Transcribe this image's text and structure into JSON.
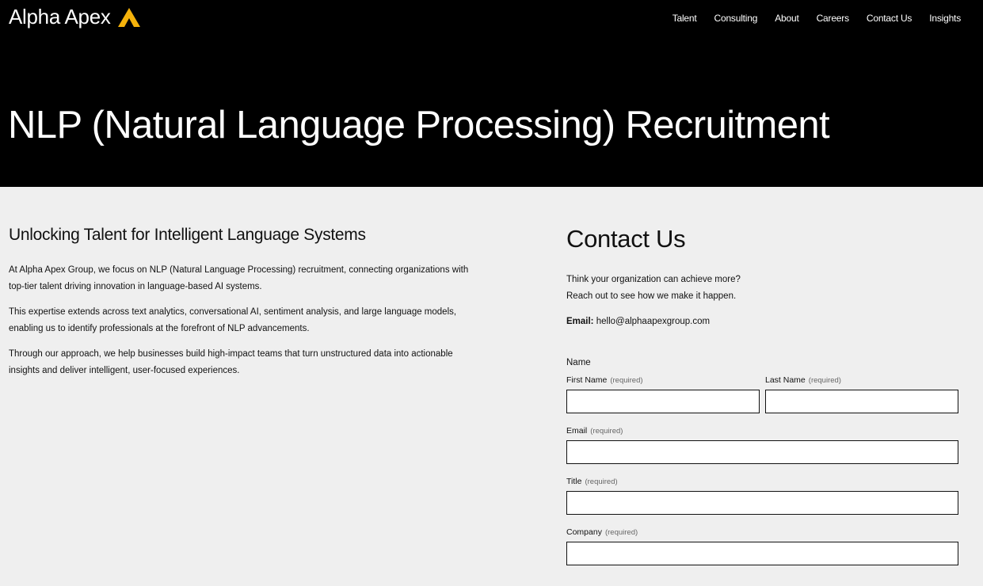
{
  "brand": {
    "name": "Alpha Apex",
    "accent_color": "#f5b20b",
    "logo_icon": "triangle-logo-icon"
  },
  "nav": {
    "items": [
      "Talent",
      "Consulting",
      "About",
      "Careers",
      "Contact Us",
      "Insights"
    ]
  },
  "hero": {
    "title": "NLP (Natural Language Processing) Recruitment"
  },
  "intro": {
    "heading": "Unlocking Talent for Intelligent Language Systems",
    "paragraphs": [
      "At Alpha Apex Group, we focus on NLP (Natural Language Processing) recruitment, connecting organizations with top-tier talent driving innovation in language-based AI systems.",
      "This expertise extends across text analytics, conversational AI, sentiment analysis, and large language models, enabling us to identify professionals at the forefront of NLP advancements.",
      "Through our approach, we help businesses build high-impact teams that turn unstructured data into actionable insights and deliver intelligent, user-focused experiences."
    ]
  },
  "contact": {
    "heading": "Contact Us",
    "line1": "Think your organization can achieve more?",
    "line2": "Reach out to see how we make it happen.",
    "email_label": "Email:",
    "email_value": "hello@alphaapexgroup.com",
    "form": {
      "name_label": "Name",
      "required_text": "(required)",
      "first_name_label": "First Name",
      "first_name_value": "",
      "last_name_label": "Last Name",
      "last_name_value": "",
      "email_label": "Email",
      "email_value": "",
      "title_label": "Title",
      "title_value": "",
      "company_label": "Company",
      "company_value": ""
    }
  }
}
